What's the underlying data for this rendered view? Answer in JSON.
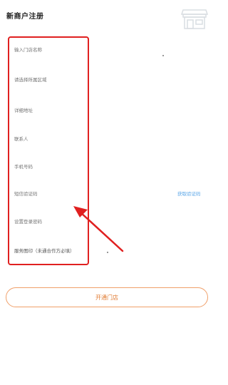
{
  "header": {
    "title": "新商户注册",
    "icon": "storefront-icon"
  },
  "form": {
    "store_name_placeholder": "输入门店名称",
    "region_placeholder": "请选择所属区域",
    "address_placeholder": "详细地址",
    "contact_placeholder": "联系人",
    "phone_placeholder": "手机号码",
    "sms_code_placeholder": "短信验证码",
    "get_code_label": "获取验证码",
    "password_placeholder": "设置登录密码",
    "service_photo_label": "服务图印（未通合作方必填）"
  },
  "actions": {
    "submit_label": "开通门店"
  },
  "colors": {
    "accent": "#e07a30",
    "link": "#5aa6e8",
    "annotation": "#e02020"
  }
}
